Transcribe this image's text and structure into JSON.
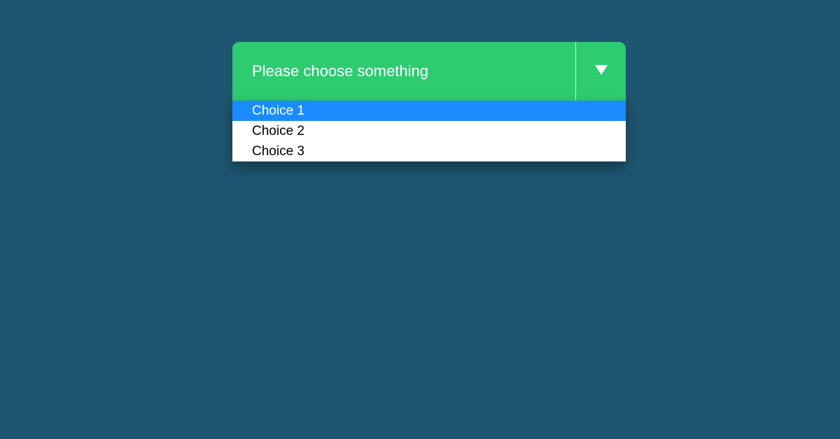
{
  "dropdown": {
    "placeholder": "Please choose something",
    "options": [
      {
        "label": "Choice 1",
        "highlighted": true
      },
      {
        "label": "Choice 2",
        "highlighted": false
      },
      {
        "label": "Choice 3",
        "highlighted": false
      }
    ],
    "colors": {
      "header_bg": "#2ecc71",
      "page_bg": "#1e5570",
      "highlight_bg": "#1a8cff"
    }
  }
}
